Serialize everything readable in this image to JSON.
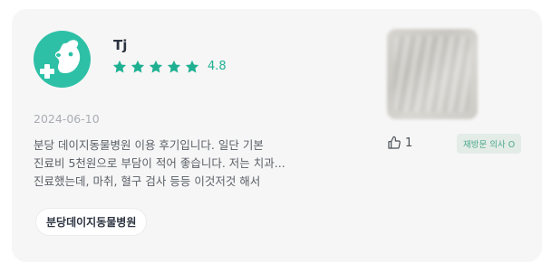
{
  "review": {
    "author": "Tj",
    "rating_value": "4.8",
    "stars_filled": 5,
    "date": "2024-06-10",
    "body_lines": [
      "분당 데이지동물병원 이용 후기입니다. 일단 기본",
      "진료비 5천원으로 부담이 적어 좋습니다. 저는 치과...",
      "진료했는데, 마취, 혈구 검사 등등 이것저것 해서"
    ],
    "like_count": "1",
    "badge": "재방문 의사 O",
    "hospital_tag": "분당데이지동물병원"
  },
  "colors": {
    "accent": "#2dc0a6",
    "star": "#1fb092",
    "card_bg": "#f6f6f6",
    "badge_bg": "#e4ece7"
  },
  "icons": {
    "avatar": "vet-dog-icon",
    "star": "star-icon",
    "like": "thumbs-up-icon"
  }
}
